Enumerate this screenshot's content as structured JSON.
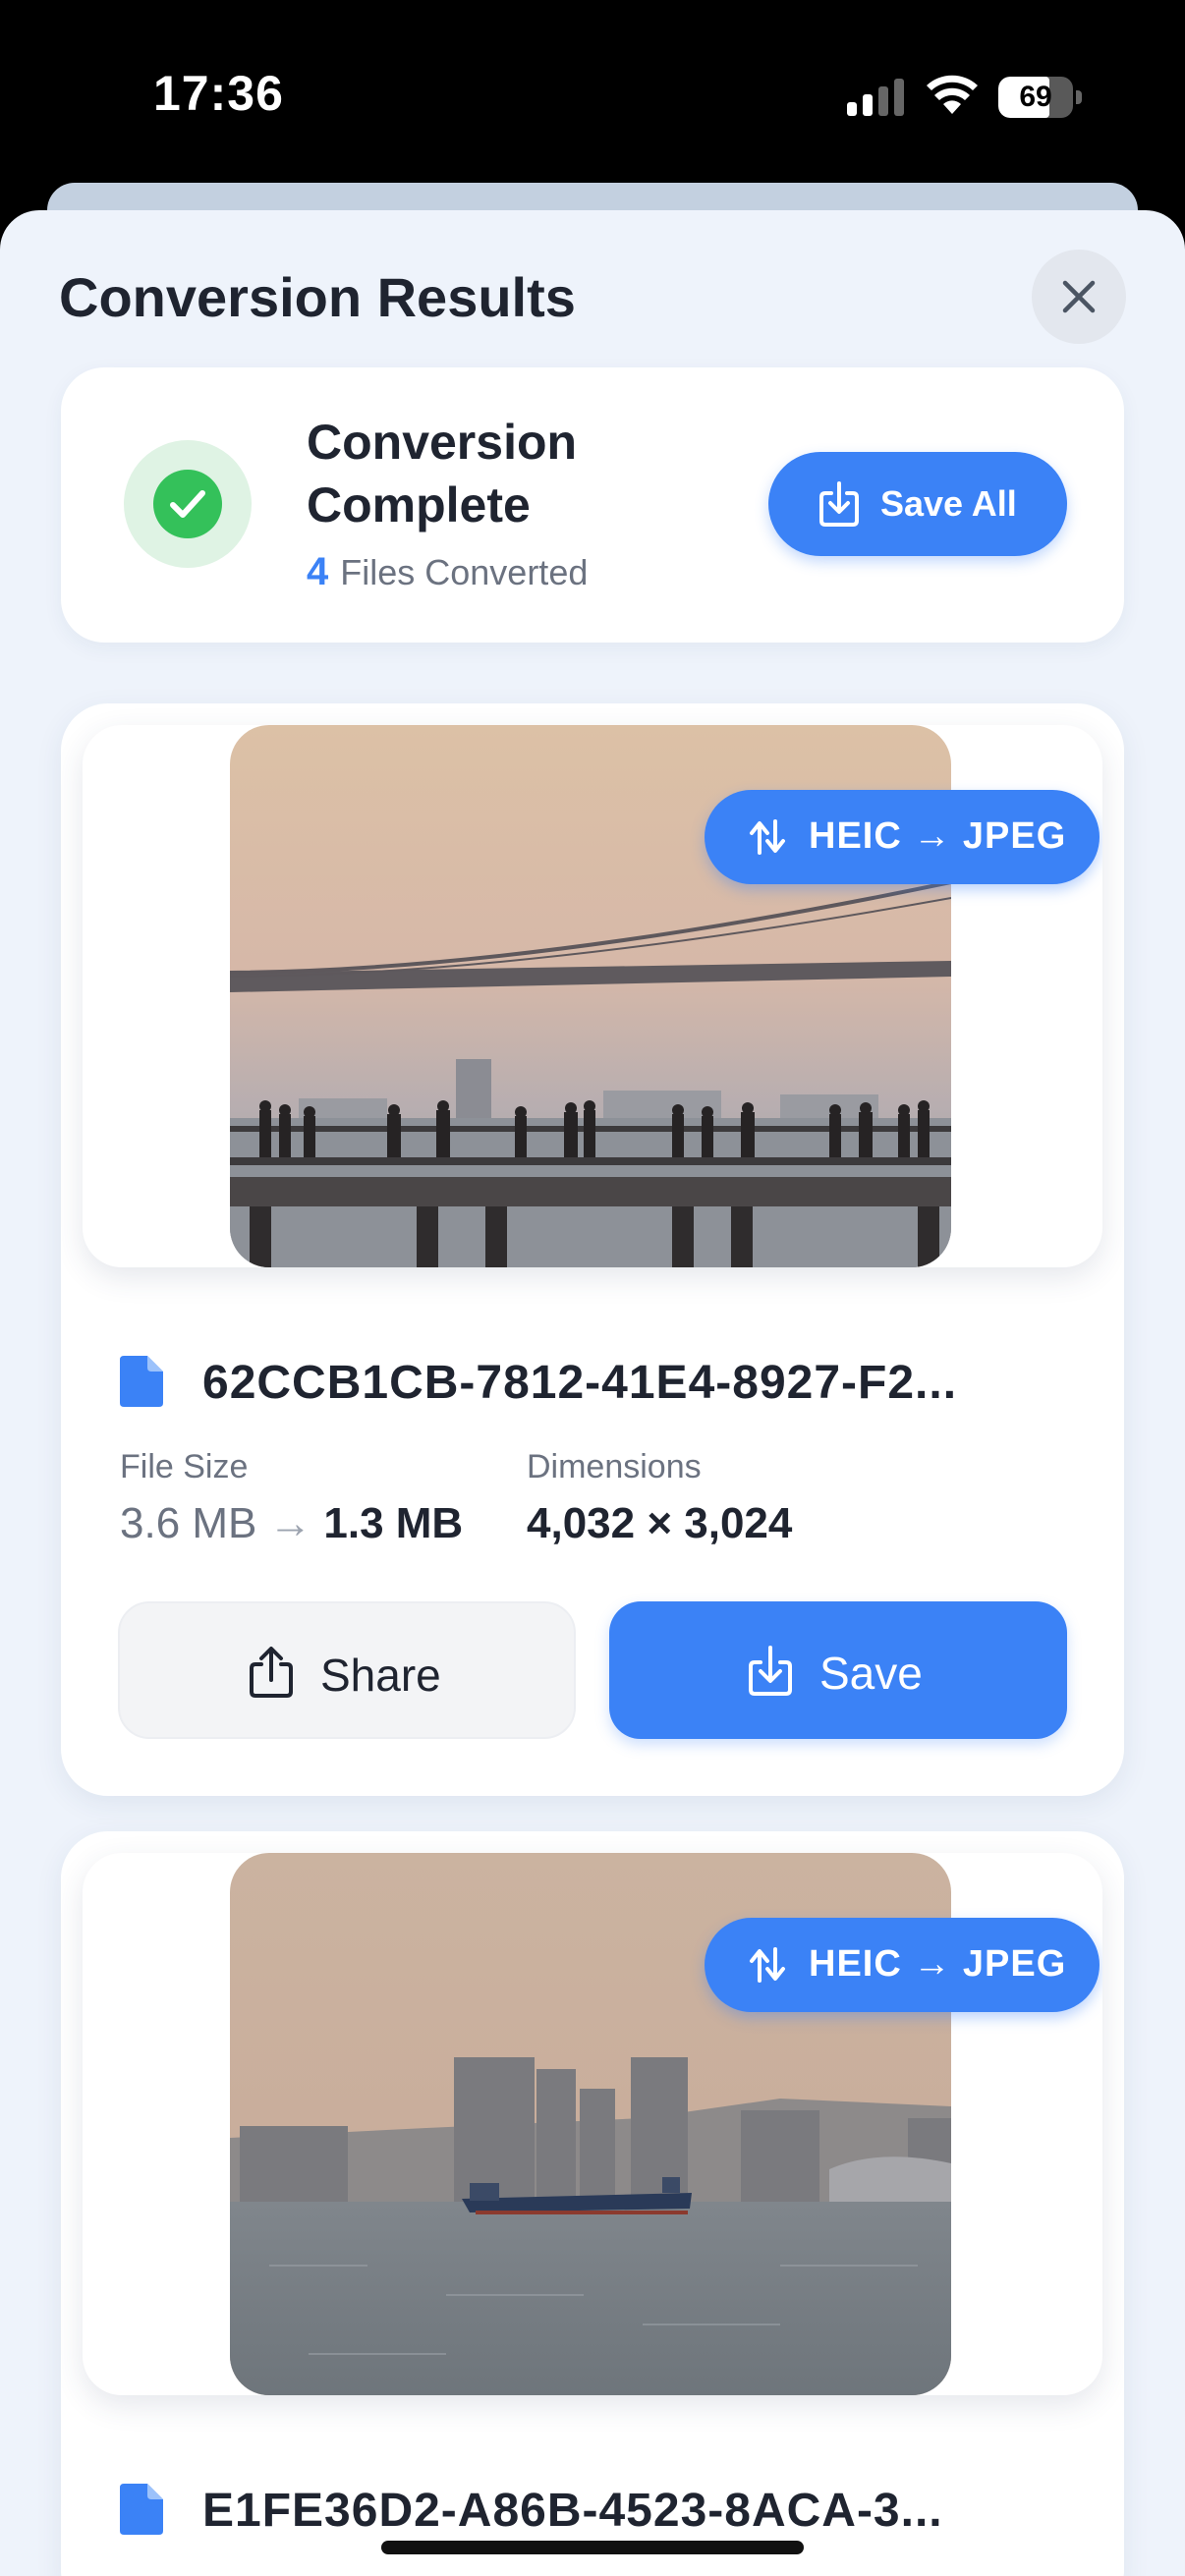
{
  "status_bar": {
    "time": "17:36",
    "battery": "69",
    "battery_level": 0.69
  },
  "sheet": {
    "title": "Conversion Results"
  },
  "summary": {
    "title": "Conversion Complete",
    "count": "4",
    "count_label": "Files Converted",
    "save_all_label": "Save All"
  },
  "files": [
    {
      "badge": "HEIC → JPEG",
      "name": "62CCB1CB-7812-41E4-8927-F2...",
      "size_label": "File Size",
      "size_from": "3.6 MB",
      "size_to": "1.3 MB",
      "dim_label": "Dimensions",
      "dimensions": "4,032 × 3,024",
      "share_label": "Share",
      "save_label": "Save"
    },
    {
      "badge": "HEIC → JPEG",
      "name": "E1FE36D2-A86B-4523-8ACA-3..."
    }
  ],
  "colors": {
    "accent": "#3b82f6",
    "success": "#34c15a",
    "background": "#eef3fb"
  },
  "icons": {
    "close": "close-icon",
    "success": "checkmark-icon",
    "save": "download-icon",
    "share": "share-icon",
    "convert": "convert-arrows-icon",
    "file": "document-icon"
  }
}
